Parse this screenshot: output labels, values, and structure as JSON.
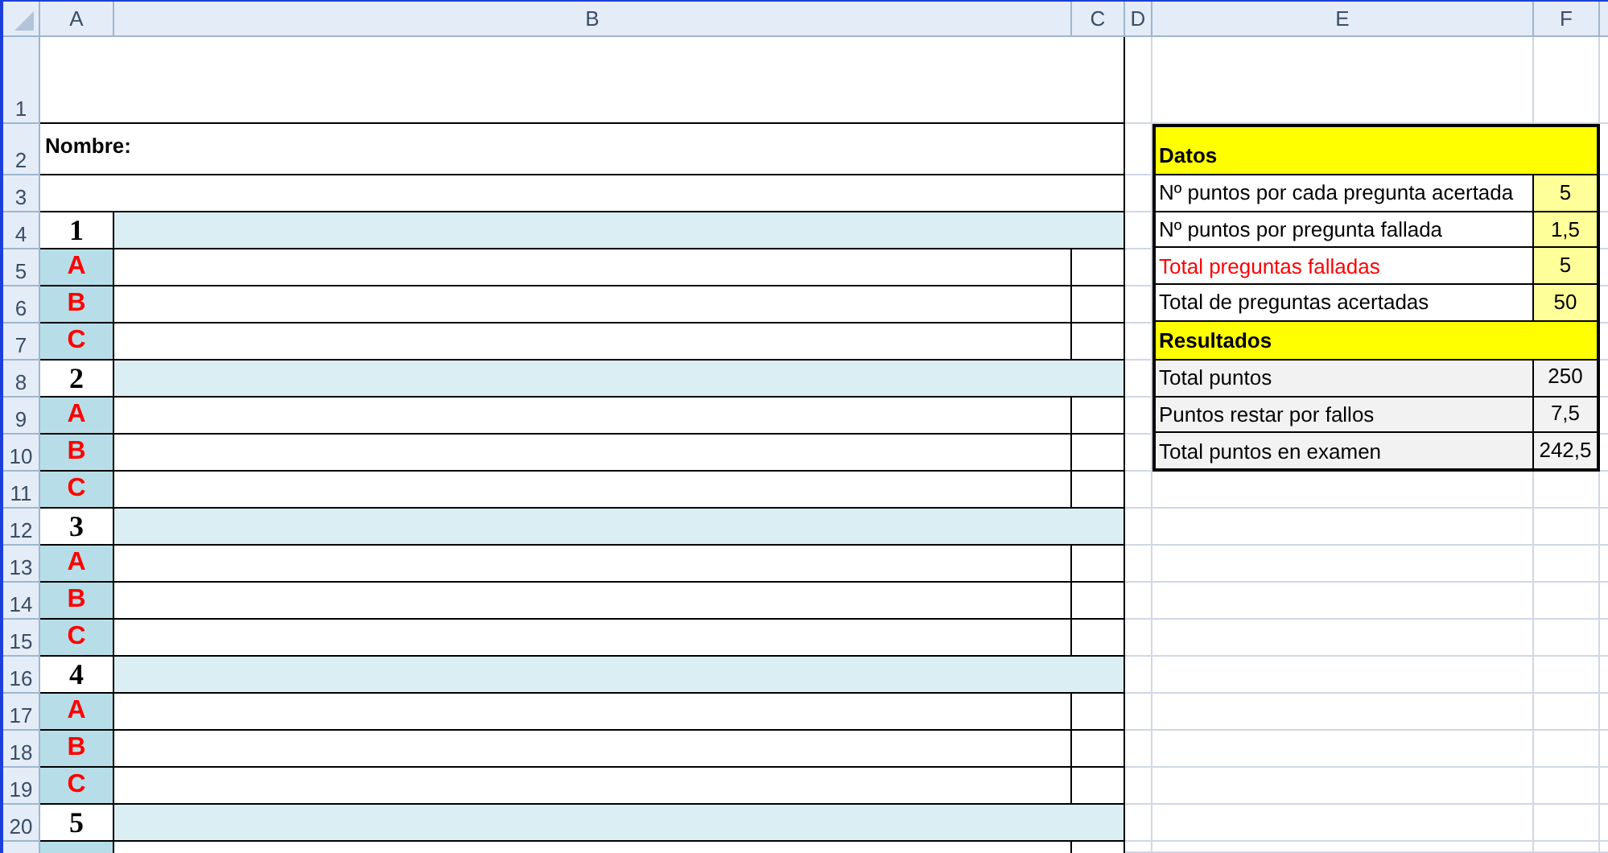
{
  "column_headers": [
    "A",
    "B",
    "C",
    "D",
    "E",
    "F"
  ],
  "row_headers": [
    "1",
    "2",
    "3",
    "4",
    "5",
    "6",
    "7",
    "8",
    "9",
    "10",
    "11",
    "12",
    "13",
    "14",
    "15",
    "16",
    "17",
    "18",
    "19",
    "20"
  ],
  "form": {
    "name_label": "Nombre:",
    "questions": [
      {
        "number": "1",
        "options": [
          "A",
          "B",
          "C"
        ]
      },
      {
        "number": "2",
        "options": [
          "A",
          "B",
          "C"
        ]
      },
      {
        "number": "3",
        "options": [
          "A",
          "B",
          "C"
        ]
      },
      {
        "number": "4",
        "options": [
          "A",
          "B",
          "C"
        ]
      },
      {
        "number": "5"
      }
    ]
  },
  "summary": {
    "data_title": "Datos",
    "data_rows": [
      {
        "label": "Nº puntos por cada pregunta acertada",
        "value": "5",
        "color": "#000000"
      },
      {
        "label": "Nº puntos por pregunta fallada",
        "value": "1,5",
        "color": "#000000"
      },
      {
        "label": "Total preguntas falladas",
        "value": "5",
        "color": "#ff0000"
      },
      {
        "label": "Total de preguntas acertadas",
        "value": "50",
        "color": "#000000"
      }
    ],
    "results_title": "Resultados",
    "result_rows": [
      {
        "label": "Total puntos",
        "value": "250"
      },
      {
        "label": "Puntos restar por fallos",
        "value": "7,5"
      },
      {
        "label": "Total puntos en examen",
        "value": "242,5"
      }
    ]
  }
}
